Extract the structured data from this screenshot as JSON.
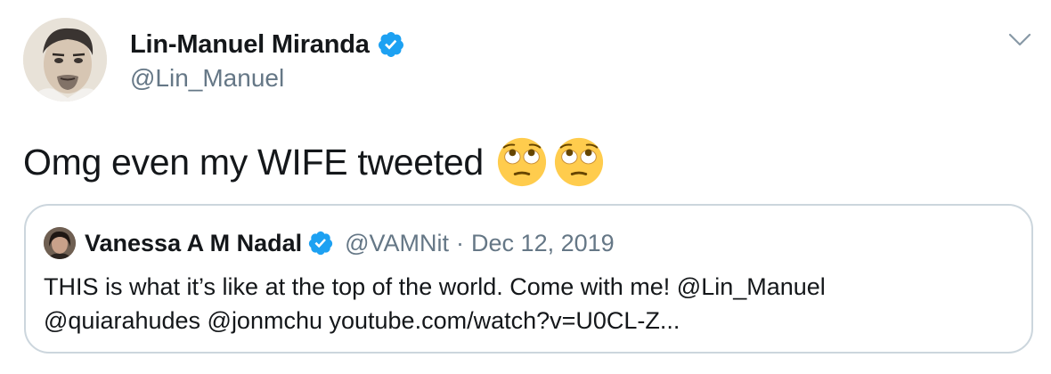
{
  "author": {
    "name": "Lin-Manuel Miranda",
    "handle": "@Lin_Manuel"
  },
  "tweet": {
    "text": "Omg even my WIFE tweeted",
    "emojis": [
      "face-with-rolling-eyes-emoji",
      "face-with-rolling-eyes-emoji"
    ]
  },
  "quoted_tweet": {
    "name": "Vanessa A M Nadal",
    "handle": "@VAMNit",
    "separator": "·",
    "date": "Dec 12, 2019",
    "body_line1": "THIS is what it’s like at the top of the world. Come with me! @Lin_Manuel",
    "body_line2": "@quiarahudes @jonmchu youtube.com/watch?v=U0CL-Z..."
  },
  "icons": {
    "verified": "verified-badge-icon",
    "menu": "chevron-down-icon"
  },
  "colors": {
    "verified": "#1da1f2",
    "secondary_text": "#657786",
    "border": "#ccd6dd",
    "emoji": "#ffcc4d"
  }
}
